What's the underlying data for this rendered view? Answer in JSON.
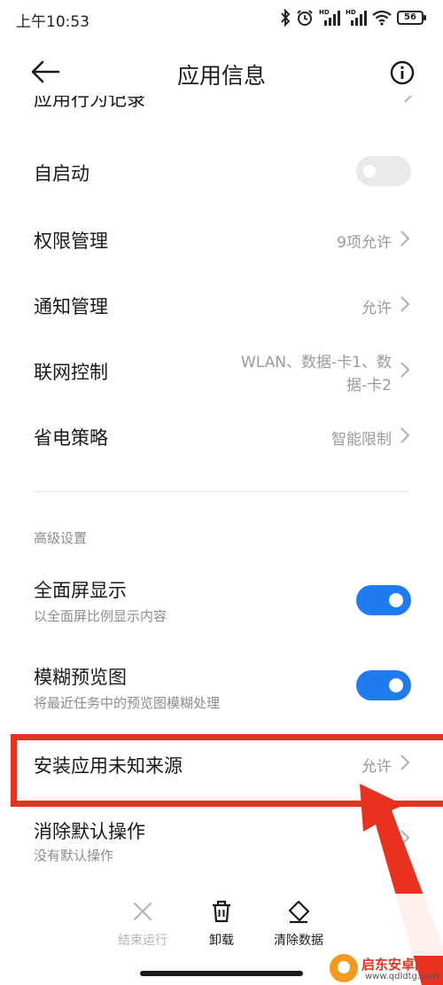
{
  "status_bar": {
    "time": "上午10:53",
    "signal_1_label": "HD",
    "signal_2_label": "HD",
    "battery": "56"
  },
  "header": {
    "title": "应用信息"
  },
  "partial_row": {
    "label": "应用行为记录"
  },
  "rows": {
    "autostart": {
      "label": "自启动",
      "enabled": false
    },
    "permissions": {
      "label": "权限管理",
      "value": "9项允许"
    },
    "notifications": {
      "label": "通知管理",
      "value": "允许"
    },
    "network": {
      "label": "联网控制",
      "value_line1": "WLAN、数据-卡1、数",
      "value_line2": "据-卡2"
    },
    "battery_saver": {
      "label": "省电策略",
      "value": "智能限制"
    }
  },
  "advanced": {
    "section_label": "高级设置",
    "fullscreen": {
      "label": "全面屏显示",
      "sublabel": "以全面屏比例显示内容",
      "enabled": true
    },
    "blur_preview": {
      "label": "模糊预览图",
      "sublabel": "将最近任务中的预览图模糊处理",
      "enabled": true
    },
    "unknown_sources": {
      "label": "安装应用未知来源",
      "value": "允许"
    },
    "clear_defaults": {
      "label": "消除默认操作",
      "sublabel": "没有默认操作"
    }
  },
  "bottom_bar": {
    "force_stop": "结束运行",
    "uninstall": "卸载",
    "clear_data": "清除数据"
  },
  "watermark": {
    "name": "启东安卓网",
    "url": "www.qdldtg.com"
  },
  "colors": {
    "accent": "#1f7bf0",
    "highlight": "#e8311f"
  }
}
